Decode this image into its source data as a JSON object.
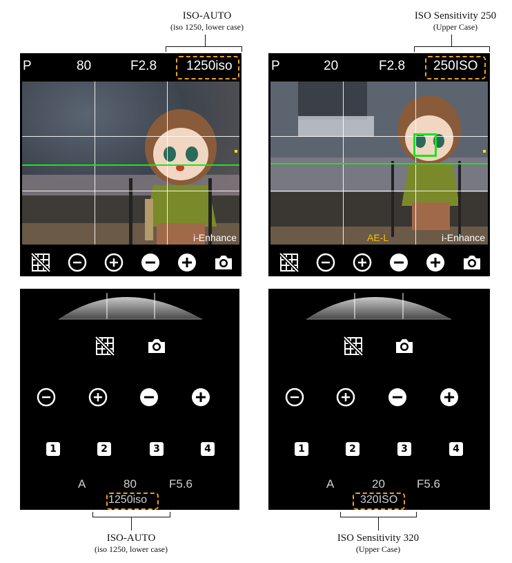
{
  "annotations": {
    "top_left": {
      "title": "ISO-AUTO",
      "subtitle": "(iso 1250, lower case)"
    },
    "top_right": {
      "title": "ISO Sensitivity 250",
      "subtitle": "(Upper Case)"
    },
    "bottom_left": {
      "title": "ISO-AUTO",
      "subtitle": "(iso 1250, lower case)"
    },
    "bottom_right": {
      "title": "ISO Sensitivity 320",
      "subtitle": "(Upper Case)"
    }
  },
  "camera_left": {
    "mode": "P",
    "shutter": "80",
    "aperture": "F2.8",
    "iso": "1250iso",
    "overlay": "i-Enhance"
  },
  "camera_right": {
    "mode": "P",
    "shutter": "20",
    "aperture": "F2.8",
    "iso": "250ISO",
    "overlay": "i-Enhance",
    "ae_lock": "AE-L"
  },
  "icon_row": [
    "grid-off-icon",
    "minus-circle-outline-icon",
    "plus-circle-outline-icon",
    "minus-circle-filled-icon",
    "plus-circle-filled-icon",
    "camera-icon"
  ],
  "remote_left": {
    "buttons": [
      "1",
      "2",
      "3",
      "4"
    ],
    "mode": "A",
    "shutter": "80",
    "aperture": "F5.6",
    "iso": "1250iso"
  },
  "remote_right": {
    "buttons": [
      "1",
      "2",
      "3",
      "4"
    ],
    "mode": "A",
    "shutter": "20",
    "aperture": "F5.6",
    "iso": "320ISO"
  },
  "colors": {
    "dashed_highlight": "#f0a020",
    "level_line": "#19e619",
    "ae_lock": "#f5c000",
    "focus_box": "#19e619"
  }
}
